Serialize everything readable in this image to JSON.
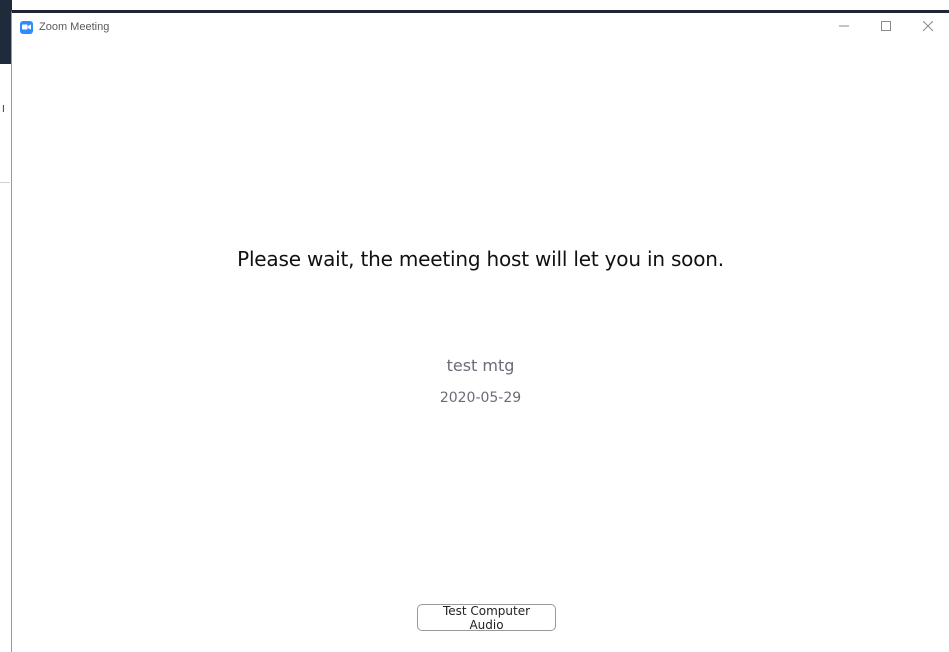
{
  "window": {
    "title": "Zoom Meeting",
    "app_icon": "zoom-camera-icon",
    "controls": {
      "minimize_icon": "minimize-icon",
      "maximize_icon": "maximize-icon",
      "close_icon": "close-icon"
    }
  },
  "background_app": {
    "glyph": "I"
  },
  "waiting_room": {
    "message": "Please wait, the meeting host will let you in soon.",
    "topic": "test mtg",
    "date": "2020-05-29",
    "test_audio_label": "Test Computer Audio"
  },
  "colors": {
    "accent": "#2d8cff",
    "title_border": "#1d2634",
    "secondary_text": "#6b6b78"
  }
}
